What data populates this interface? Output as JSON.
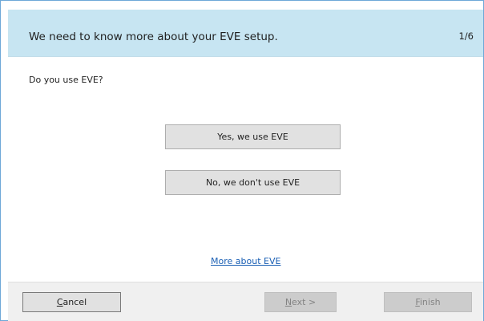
{
  "header": {
    "title": "We need to know more about your EVE setup.",
    "step": "1/6"
  },
  "content": {
    "question": "Do you use EVE?",
    "choices": [
      {
        "label": "Yes, we use EVE"
      },
      {
        "label": "No, we don't use EVE"
      }
    ],
    "more_link": "More about EVE"
  },
  "footer": {
    "cancel_label": "Cancel",
    "next_label": "Next >",
    "finish_label": "Finish"
  },
  "colors": {
    "header_bg": "#c7e5f2",
    "footer_bg": "#f0f0f0",
    "link": "#1a5fb4",
    "window_border": "#6ea8d8"
  }
}
